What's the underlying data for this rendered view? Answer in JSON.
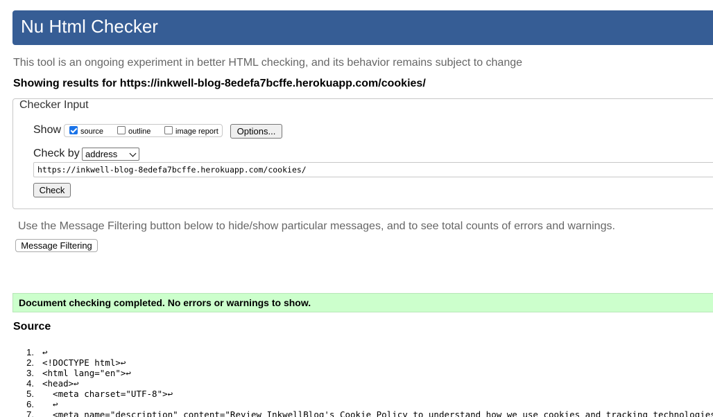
{
  "app": {
    "title": "Nu Html Checker",
    "tagline": "This tool is an ongoing experiment in better HTML checking, and its behavior remains subject to change",
    "showing_results": "Showing results for https://inkwell-blog-8edefa7bcffe.herokuapp.com/cookies/"
  },
  "checker_input": {
    "legend": "Checker Input",
    "show_label": "Show",
    "show_options": [
      {
        "label": "source",
        "checked": true
      },
      {
        "label": "outline",
        "checked": false
      },
      {
        "label": "image report",
        "checked": false
      }
    ],
    "options_button": "Options...",
    "check_by_label": "Check by",
    "check_by_value": "address",
    "url_value": "https://inkwell-blog-8edefa7bcffe.herokuapp.com/cookies/",
    "check_button": "Check"
  },
  "filtering": {
    "hint": "Use the Message Filtering button below to hide/show particular messages, and to see total counts of errors and warnings.",
    "button": "Message Filtering"
  },
  "result": {
    "message": "Document checking completed. No errors or warnings to show.",
    "color": "#ccffcc"
  },
  "source": {
    "heading": "Source",
    "lines": [
      {
        "num": "1.",
        "code": "↩"
      },
      {
        "num": "2.",
        "code": "<!DOCTYPE html>↩"
      },
      {
        "num": "3.",
        "code": "<html lang=\"en\">↩"
      },
      {
        "num": "4.",
        "code": "<head>↩"
      },
      {
        "num": "5.",
        "code": "  <meta charset=\"UTF-8\">↩"
      },
      {
        "num": "6.",
        "code": "  ↩"
      },
      {
        "num": "7.",
        "code": "  <meta name=\"description\" content=\"Review InkwellBlog's Cookie Policy to understand how we use cookies and tracking technologies"
      }
    ]
  },
  "colors": {
    "title_bar": "#365d95",
    "muted_text": "#666666",
    "success_bg": "#ccffcc"
  }
}
